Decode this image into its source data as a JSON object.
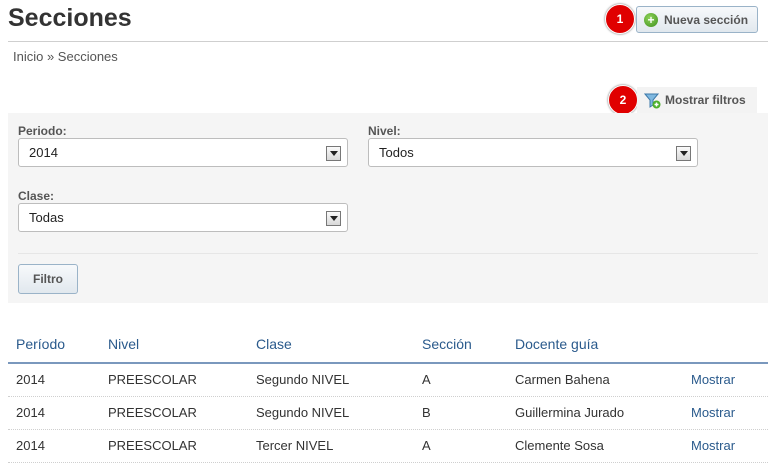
{
  "page": {
    "title": "Secciones"
  },
  "actions": {
    "new_section": "Nueva sección",
    "show_filters": "Mostrar filtros"
  },
  "markers": [
    "1",
    "2"
  ],
  "breadcrumb": "Inicio » Secciones",
  "filters": {
    "periodo": {
      "label": "Periodo:",
      "value": "2014"
    },
    "nivel": {
      "label": "Nivel:",
      "value": "Todos"
    },
    "clase": {
      "label": "Clase:",
      "value": "Todas"
    },
    "submit": "Filtro"
  },
  "table": {
    "headers": [
      "Período",
      "Nivel",
      "Clase",
      "Sección",
      "Docente guía"
    ],
    "rows": [
      {
        "periodo": "2014",
        "nivel": "PREESCOLAR",
        "clase": "Segundo NIVEL",
        "seccion": "A",
        "docente": "Carmen Bahena",
        "action": "Mostrar"
      },
      {
        "periodo": "2014",
        "nivel": "PREESCOLAR",
        "clase": "Segundo NIVEL",
        "seccion": "B",
        "docente": "Guillermina Jurado",
        "action": "Mostrar"
      },
      {
        "periodo": "2014",
        "nivel": "PREESCOLAR",
        "clase": "Tercer NIVEL",
        "seccion": "A",
        "docente": "Clemente Sosa",
        "action": "Mostrar"
      }
    ]
  },
  "icons": {
    "new": "plus-circle-icon",
    "filters": "funnel-plus-icon",
    "dropdown": "chevron-down-icon"
  },
  "colors": {
    "link": "#2a5a8c",
    "marker": "#e00000",
    "accent_green": "#4caf2a"
  }
}
